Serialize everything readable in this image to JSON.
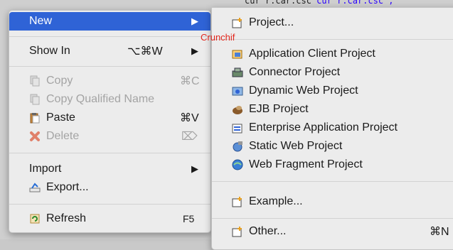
{
  "editor": {
    "code_prefix": "cur r.car.csc",
    "code_string": "cur r.car.csc ;"
  },
  "context_menu": {
    "new": "New",
    "show_in": "Show In",
    "show_in_shortcut": "⌥⌘W",
    "copy": "Copy",
    "copy_shortcut": "⌘C",
    "copy_qualified": "Copy Qualified Name",
    "paste": "Paste",
    "paste_shortcut": "⌘V",
    "delete": "Delete",
    "delete_shortcut": "⌦",
    "import": "Import",
    "export": "Export...",
    "refresh": "Refresh",
    "refresh_shortcut": "F5",
    "arrow": "▶"
  },
  "submenu": {
    "project": "Project...",
    "app_client": "Application Client Project",
    "connector": "Connector Project",
    "dynamic_web": "Dynamic Web Project",
    "ejb": "EJB Project",
    "enterprise_app": "Enterprise Application Project",
    "static_web": "Static Web Project",
    "web_fragment": "Web Fragment Project",
    "example": "Example...",
    "other": "Other...",
    "other_shortcut": "⌘N"
  },
  "overlay": {
    "crunchify": "Crunchif"
  },
  "colors": {
    "selection": "#2f63d6",
    "accent_red": "#e2261c"
  }
}
